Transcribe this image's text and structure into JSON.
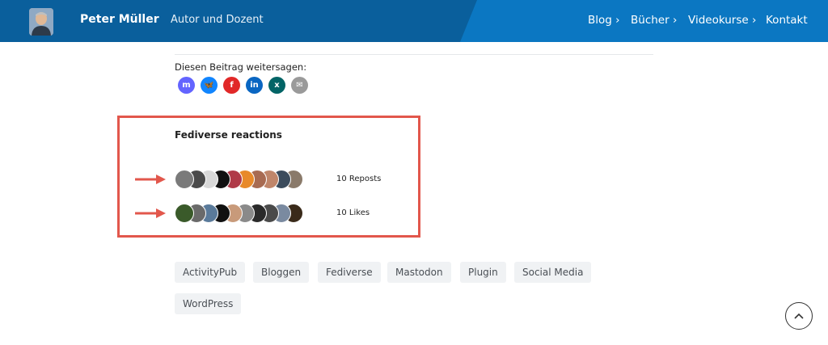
{
  "header": {
    "site_name": "Peter Müller",
    "tagline": "Autor und Dozent",
    "nav": [
      {
        "label": "Blog ›"
      },
      {
        "label": "Bücher ›"
      },
      {
        "label": "Videokurse ›"
      },
      {
        "label": "Kontakt"
      }
    ],
    "colors": {
      "left": "#0a5f9c",
      "right": "#0b77c2"
    }
  },
  "share": {
    "label": "Diesen Beitrag weitersagen:",
    "icons": [
      {
        "name": "mastodon-icon",
        "color": "#6364ff",
        "glyph": "m"
      },
      {
        "name": "bluesky-icon",
        "color": "#1185fe",
        "glyph": "🦋"
      },
      {
        "name": "flipboard-icon",
        "color": "#e12828",
        "glyph": "f"
      },
      {
        "name": "linkedin-icon",
        "color": "#0a66c2",
        "glyph": "in"
      },
      {
        "name": "xing-icon",
        "color": "#026466",
        "glyph": "x"
      },
      {
        "name": "email-icon",
        "color": "#9a9a9a",
        "glyph": "✉"
      }
    ]
  },
  "fediverse": {
    "title": "Fediverse reactions",
    "reposts": {
      "label": "10 Reposts",
      "avatars": [
        "#7a7a7a",
        "#4a4a4a",
        "#d8d8d8",
        "#111111",
        "#b03a48",
        "#e88a2a",
        "#a86b52",
        "#c0866a",
        "#3b4b5c",
        "#8a7a6a"
      ]
    },
    "likes": {
      "label": "10 Likes",
      "avatars": [
        "#3a5a2a",
        "#6a6a6a",
        "#5a7a9a",
        "#111111",
        "#c89a7a",
        "#8a8a8a",
        "#2a2a2a",
        "#4a4a4a",
        "#7a8aa0",
        "#3a2a1a"
      ]
    }
  },
  "tags": [
    {
      "label": "ActivityPub"
    },
    {
      "label": "Bloggen"
    },
    {
      "label": "Fediverse"
    },
    {
      "label": "Mastodon"
    },
    {
      "label": "Plugin"
    },
    {
      "label": "Social Media"
    },
    {
      "label": "WordPress"
    }
  ],
  "annotation_color": "#e2574c"
}
